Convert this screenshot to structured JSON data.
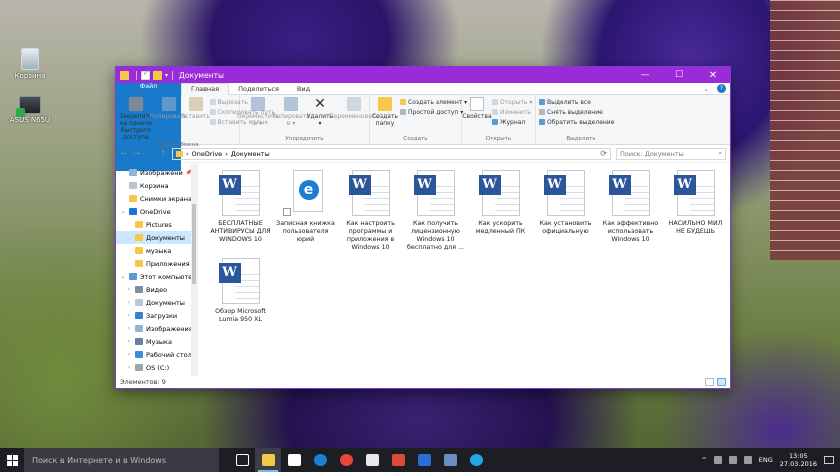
{
  "desktop": {
    "icons": [
      {
        "label": "Корзина"
      },
      {
        "label": "ASUS N65U"
      }
    ]
  },
  "window": {
    "title": "Документы",
    "controls": {
      "minimize": "—",
      "maximize": "☐",
      "close": "✕"
    }
  },
  "tabs": {
    "file": "Файл",
    "home": "Главная",
    "share": "Поделиться",
    "view": "Вид",
    "help": "?"
  },
  "ribbon": {
    "clipboard": {
      "pin": "Закрепить на панели быстрого доступа",
      "copy": "Копировать",
      "paste": "Вставить",
      "cut": "Вырезать",
      "copy_path": "Скопировать путь",
      "paste_shortcut": "Вставить ярлык",
      "label": "Буфер обмена"
    },
    "organize": {
      "move_to": "Переместить в ▾",
      "copy_to": "Копировать в ▾",
      "delete": "Удалить ▾",
      "rename": "Переименовать",
      "label": "Упорядочить"
    },
    "new": {
      "new_folder": "Создать папку",
      "new_item": "Создать элемент ▾",
      "easy_access": "Простой доступ ▾",
      "label": "Создать"
    },
    "open": {
      "properties": "Свойства",
      "open": "Открыть ▾",
      "edit": "Изменить",
      "history": "Журнал",
      "label": "Открыть"
    },
    "select": {
      "select_all": "Выделить все",
      "select_none": "Снять выделение",
      "invert": "Обратить выделение",
      "label": "Выделить"
    }
  },
  "address": {
    "back": "←",
    "forward": "→",
    "recent": "⌄",
    "up": "↑",
    "path": [
      "OneDrive",
      "Документы"
    ],
    "separator": "›",
    "refresh": "⟳",
    "search_placeholder": "Поиск: Документы"
  },
  "nav": {
    "items": [
      {
        "label": "Изображени",
        "chev": "",
        "color": "#8fb5d8",
        "pin": "📌"
      },
      {
        "label": "Корзина",
        "chev": "",
        "color": "#b8c4cf",
        "pin": ""
      },
      {
        "label": "Снимки экрана",
        "chev": "",
        "color": "#f5c847",
        "pin": ""
      },
      {
        "label": "OneDrive",
        "chev": "⌄",
        "color": "#1e74d6",
        "pin": ""
      },
      {
        "label": "Pictures",
        "chev": "",
        "color": "#f5c847",
        "pin": ""
      },
      {
        "label": "Документы",
        "chev": "",
        "color": "#f5c847",
        "pin": "",
        "selected": true
      },
      {
        "label": "музыка",
        "chev": "",
        "color": "#f5c847",
        "pin": ""
      },
      {
        "label": "Приложения",
        "chev": "",
        "color": "#f5c847",
        "pin": ""
      },
      {
        "label": "Этот компьютер",
        "chev": "⌄",
        "color": "#5a9bd6",
        "pin": ""
      },
      {
        "label": "Видео",
        "chev": "›",
        "color": "#7b8ea3",
        "pin": ""
      },
      {
        "label": "Документы",
        "chev": "›",
        "color": "#b9c7d4",
        "pin": ""
      },
      {
        "label": "Загрузки",
        "chev": "›",
        "color": "#3a7fd0",
        "pin": ""
      },
      {
        "label": "Изображения",
        "chev": "›",
        "color": "#8fb5d8",
        "pin": ""
      },
      {
        "label": "Музыка",
        "chev": "›",
        "color": "#6a7fa0",
        "pin": ""
      },
      {
        "label": "Рабочий стол",
        "chev": "›",
        "color": "#3a8fd8",
        "pin": ""
      },
      {
        "label": "OS (C:)",
        "chev": "›",
        "color": "#9aa7b3",
        "pin": ""
      }
    ]
  },
  "files": [
    {
      "name": "БЕСПЛАТНЫЕ АНТИВИРУСЫ ДЛЯ WINDOWS 10",
      "icon": "word-doc-icon",
      "glyph": "W"
    },
    {
      "name": "Записная книжка пользователя юрий",
      "icon": "edge-doc-icon",
      "glyph": "e"
    },
    {
      "name": "Как настроить программы и приложения в Windows 10",
      "icon": "word-doc-icon",
      "glyph": "W"
    },
    {
      "name": "Как получить лицензионную Windows 10 бесплатно для ...",
      "icon": "word-doc-icon",
      "glyph": "W"
    },
    {
      "name": "Как ускорить медленный ПК",
      "icon": "word-doc-icon",
      "glyph": "W"
    },
    {
      "name": "Как установить официальную",
      "icon": "word-doc-icon",
      "glyph": "W"
    },
    {
      "name": "Как эффективно использовать Windows 10",
      "icon": "word-doc-icon",
      "glyph": "W"
    },
    {
      "name": "НАСИЛЬНО МИЛ НЕ БУДЕШЬ",
      "icon": "word-doc-icon",
      "glyph": "W"
    },
    {
      "name": "Обзор Microsoft Lumia 950 XL",
      "icon": "word-doc-icon",
      "glyph": "W"
    }
  ],
  "status": {
    "count": "Элементов: 9"
  },
  "taskbar": {
    "search_placeholder": "Поиск в Интернете и в Windows",
    "apps": [
      {
        "name": "task-view",
        "color": "#ffffff",
        "active": false
      },
      {
        "name": "explorer",
        "color": "#f5c847",
        "active": true
      },
      {
        "name": "store",
        "color": "#ffffff",
        "active": false
      },
      {
        "name": "edge",
        "color": "#1b7ed4",
        "active": false
      },
      {
        "name": "chrome",
        "color": "#e5483a",
        "active": false
      },
      {
        "name": "yandex",
        "color": "#e8e8e8",
        "active": false
      },
      {
        "name": "ccleaner",
        "color": "#d94a38",
        "active": false
      },
      {
        "name": "app-blue",
        "color": "#2b6fd6",
        "active": false
      },
      {
        "name": "photos",
        "color": "#6a8ebf",
        "active": false
      },
      {
        "name": "skype",
        "color": "#1fa8e8",
        "active": false
      }
    ],
    "lang": "ENG",
    "time": "13:05",
    "date": "27.03.2016"
  }
}
